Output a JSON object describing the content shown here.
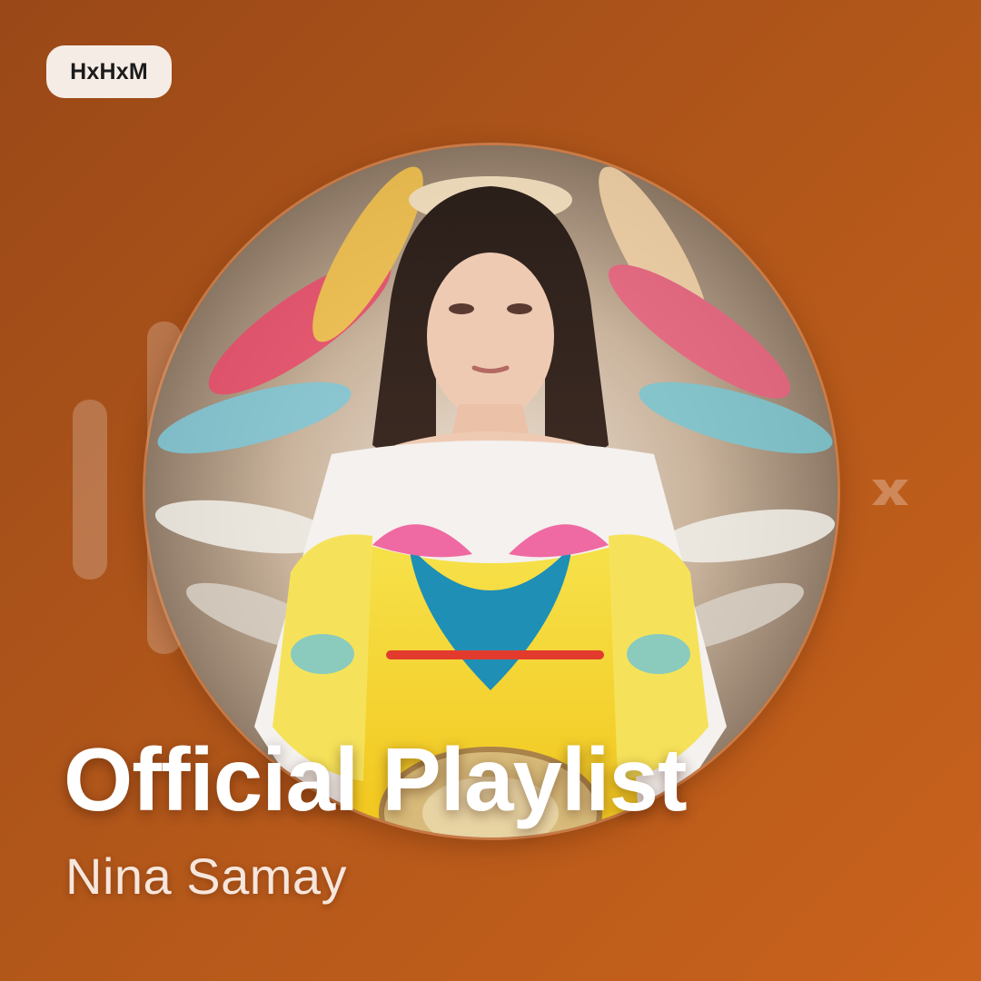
{
  "badge": {
    "label": "HxHxM"
  },
  "cover": {
    "title": "Official Playlist",
    "artist": "Nina Samay",
    "photo_icon": "artist-portrait-image",
    "decoration_icon": "brand-mark-icon"
  },
  "colors": {
    "background_start": "#9a4818",
    "background_end": "#c9621c",
    "badge_bg": "#f6ece6",
    "title": "#ffffff",
    "subtitle": "#f6e6dc"
  }
}
